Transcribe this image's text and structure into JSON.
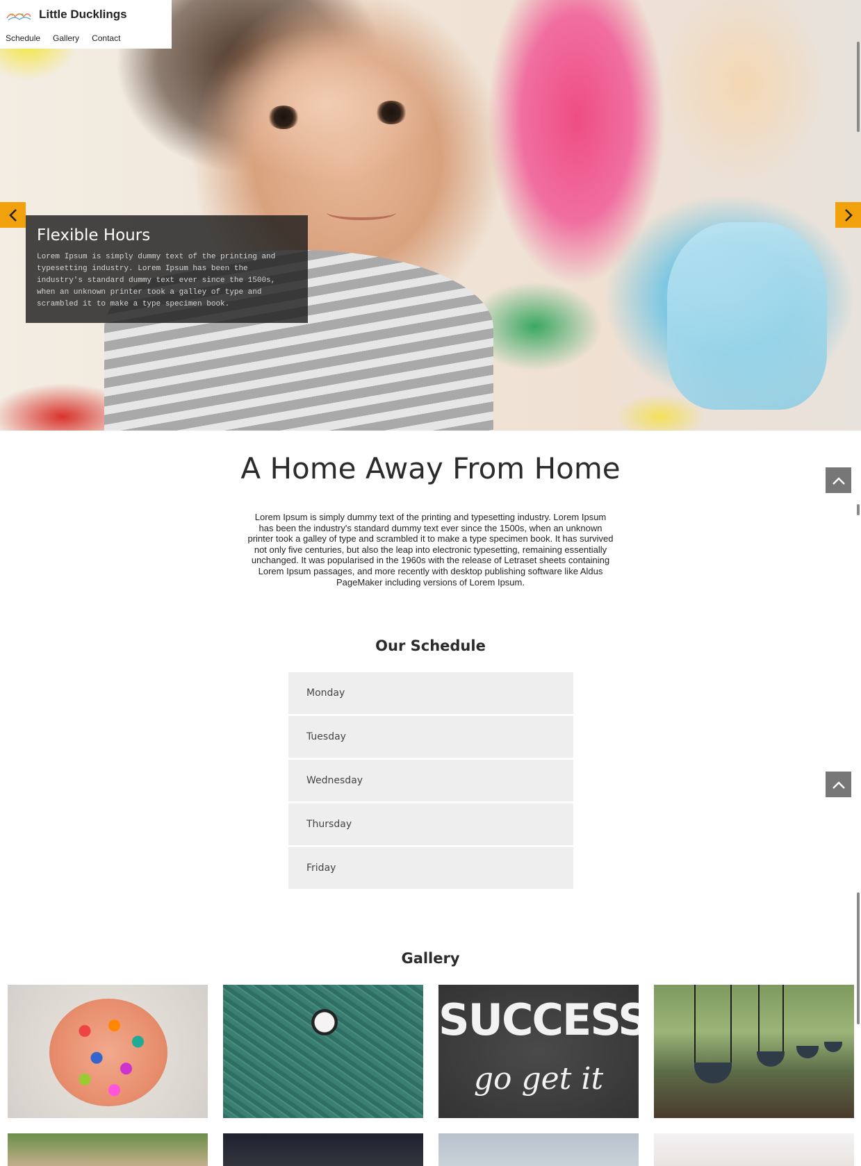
{
  "brand": {
    "name": "Little Ducklings",
    "logo_icon": "ducklings-logo-icon"
  },
  "nav": {
    "items": [
      {
        "label": "Schedule"
      },
      {
        "label": "Gallery"
      },
      {
        "label": "Contact"
      }
    ]
  },
  "hero": {
    "caption_title": "Flexible Hours",
    "caption_text": "Lorem Ipsum is simply dummy text of the printing and typesetting industry. Lorem Ipsum has been the industry's standard dummy text ever since the 1500s, when an unknown printer took a galley of type and scrambled it to make a type specimen book.",
    "prev_icon": "chevron-left-icon",
    "next_icon": "chevron-right-icon",
    "accent_color": "#f0a10b"
  },
  "intro": {
    "title": "A Home Away From Home",
    "text": "Lorem Ipsum is simply dummy text of the printing and typesetting industry. Lorem Ipsum has been the industry's standard dummy text ever since the 1500s, when an unknown printer took a galley of type and scrambled it to make a type specimen book. It has survived not only five centuries, but also the leap into electronic typesetting, remaining essentially unchanged. It was popularised in the 1960s with the release of Letraset sheets containing Lorem Ipsum passages, and more recently with desktop publishing software like Aldus PageMaker including versions of Lorem Ipsum."
  },
  "schedule": {
    "title": "Our Schedule",
    "days": [
      {
        "label": "Monday"
      },
      {
        "label": "Tuesday"
      },
      {
        "label": "Wednesday"
      },
      {
        "label": "Thursday"
      },
      {
        "label": "Friday"
      }
    ]
  },
  "gallery": {
    "title": "Gallery",
    "images": [
      {
        "subject": "colored-pencils"
      },
      {
        "subject": "chalkboard-clock"
      },
      {
        "subject": "success-chalkboard",
        "chalk_line_1": "SUCCESS",
        "chalk_line_2": "go get it"
      },
      {
        "subject": "playground-swings"
      },
      {
        "subject": "children-outdoors"
      },
      {
        "subject": "child-portrait"
      },
      {
        "subject": "grey-background"
      },
      {
        "subject": "girl-playroom"
      }
    ]
  },
  "controls": {
    "back_to_top_icon": "chevron-up-icon"
  }
}
